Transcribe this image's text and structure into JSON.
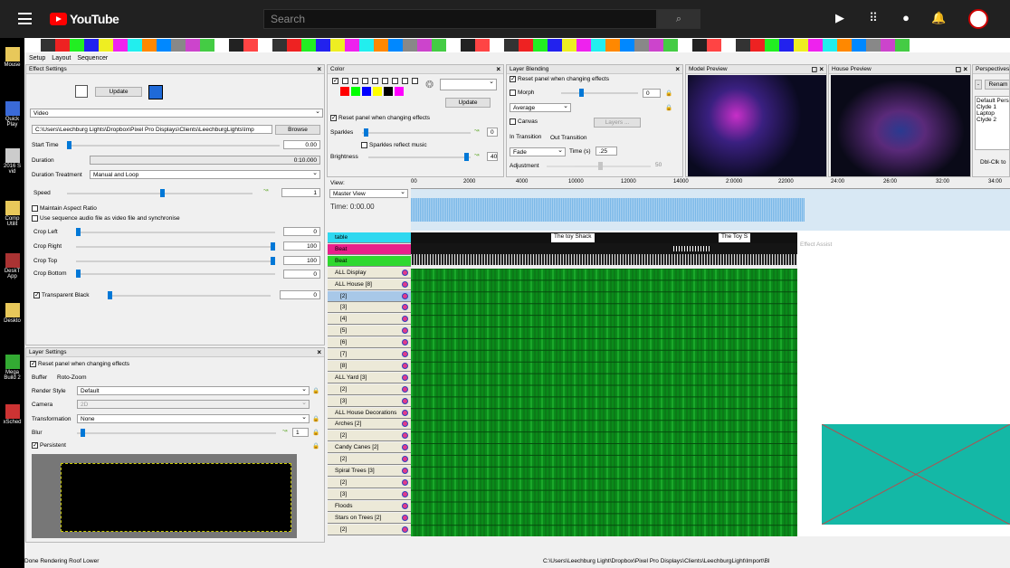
{
  "browser": {
    "site_name": "YouTube",
    "search_placeholder": "Search"
  },
  "desktop_icons": [
    "Mouse",
    "Quick Play",
    "2016 S vid",
    "Comp Utilit",
    "DeskT App",
    "Deskto",
    "Mega Build 2",
    "xSched"
  ],
  "menu": [
    "Setup",
    "Layout",
    "Sequencer"
  ],
  "effect_settings": {
    "title": "Effect Settings",
    "update": "Update",
    "effect_type": "Video",
    "file_path": "C:\\Users\\Leechburg Lights\\Dropbox\\Pixel Pro Displays\\Clients\\LeechburgLights\\Imp",
    "browse": "Browse",
    "start_time_label": "Start Time",
    "start_time": "0.00",
    "duration_label": "Duration",
    "duration": "0:10.000",
    "treatment_label": "Duration Treatment",
    "treatment": "Manual and Loop",
    "speed_label": "Speed",
    "speed": "1",
    "maintain_aspect": "Maintain Aspect Ratio",
    "use_audio": "Use sequence audio file as video file and synchronise",
    "crop_left_label": "Crop Left",
    "crop_left": "0",
    "crop_right_label": "Crop Right",
    "crop_right": "100",
    "crop_top_label": "Crop Top",
    "crop_top": "100",
    "crop_bottom_label": "Crop Bottom",
    "crop_bottom": "0",
    "transparent_black": "Transparent Black",
    "transparent_black_value": "0"
  },
  "layer_settings": {
    "title": "Layer Settings",
    "reset": "Reset panel when changing effects",
    "buffer_label": "Buffer",
    "buffer": "Roto-Zoom",
    "render_style_label": "Render Style",
    "render_style": "Default",
    "camera_label": "Camera",
    "camera": "2D",
    "transformation_label": "Transformation",
    "transformation": "None",
    "blur_label": "Blur",
    "blur": "1",
    "persistent": "Persistent"
  },
  "color": {
    "title": "Color",
    "update": "Update",
    "reset": "Reset panel when changing effects",
    "sparkles": "Sparkles",
    "sparkles_value": "0",
    "sparkles_music": "Sparkles reflect music",
    "brightness": "Brightness",
    "brightness_value": "40",
    "swatches": [
      "#ff0000",
      "#00ff00",
      "#0000ff",
      "#ffff00",
      "#000000",
      "#ff00ff"
    ]
  },
  "layer_blending": {
    "title": "Layer Blending",
    "reset": "Reset panel when changing effects",
    "morph": "Morph",
    "morph_value": "0",
    "mode": "Average",
    "canvas": "Canvas",
    "layers": "Layers ...",
    "in_transition": "In Transition",
    "out_transition": "Out Transition",
    "fade": "Fade",
    "time_label": "Time (s)",
    "time": ".25",
    "adjustment": "Adjustment",
    "adjustment_value": "50"
  },
  "model_preview": {
    "title": "Model Preview"
  },
  "house_preview": {
    "title": "House Preview"
  },
  "perspectives": {
    "title": "Perspectives",
    "rename": "Renam",
    "items": [
      "Default Pers",
      "Clyde 1",
      "Laptop",
      "Clyde 2"
    ],
    "hint": "Dbl-Clk to"
  },
  "view": {
    "label": "View:",
    "value": "Master View",
    "time": "Time: 0:00.00"
  },
  "ruler": [
    "00",
    "2000",
    "4000",
    "10000",
    "12000",
    "14000",
    "2:0000",
    "22000",
    "24:00",
    "26:00",
    "32:00",
    "34:00"
  ],
  "rows": [
    {
      "label": "table",
      "color": "#2fd8f0"
    },
    {
      "label": "Beat",
      "color": "#e8208a"
    },
    {
      "label": "Beat",
      "color": "#2fd82f"
    },
    {
      "label": "ALL Display"
    },
    {
      "label": "ALL House [8]"
    },
    {
      "label": "[2]"
    },
    {
      "label": "[3]"
    },
    {
      "label": "[4]"
    },
    {
      "label": "[5]"
    },
    {
      "label": "[6]"
    },
    {
      "label": "[7]"
    },
    {
      "label": "[8]"
    },
    {
      "label": "ALL Yard [3]"
    },
    {
      "label": "[2]"
    },
    {
      "label": "[3]"
    },
    {
      "label": "ALL House Decorations"
    },
    {
      "label": "Arches [2]"
    },
    {
      "label": "[2]"
    },
    {
      "label": "Candy Canes [2]"
    },
    {
      "label": "[2]"
    },
    {
      "label": "Spiral Trees [3]"
    },
    {
      "label": "[2]"
    },
    {
      "label": "[3]"
    },
    {
      "label": "Floods"
    },
    {
      "label": "Stars on Trees [2]"
    },
    {
      "label": "[2]"
    }
  ],
  "labels_track": [
    "The toy Shack",
    "The Toy S"
  ],
  "effect_assist": "Effect Assist",
  "status": {
    "left": "Done Rendering Roof Lower",
    "right": "C:\\Users\\Leechburg Light\\Dropbox\\Pixel Pro Displays\\Clients\\LeechburgLight\\Import\\Bl"
  }
}
